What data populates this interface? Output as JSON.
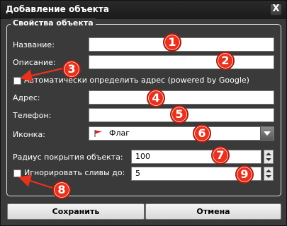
{
  "window": {
    "title": "Добавление объекта",
    "close_label": "X"
  },
  "fieldset": {
    "legend": "Свойства объекта"
  },
  "form": {
    "name_label": "Название:",
    "name_value": "",
    "description_label": "Описание:",
    "description_value": "",
    "auto_address_label": "Автоматически определить адрес (powered by Google)",
    "auto_address_checked": false,
    "address_label": "Адрес:",
    "address_value": "",
    "phone_label": "Телефон:",
    "phone_value": "",
    "icon_label": "Иконка:",
    "icon_selected": "Флаг",
    "icon_selected_icon": "red-flag-icon",
    "radius_label": "Радиус покрытия объекта:",
    "radius_value": "100",
    "ignore_label": "Игнорировать сливы до:",
    "ignore_checked": false,
    "ignore_value": "5"
  },
  "buttons": {
    "save": "Сохранить",
    "cancel": "Отмена"
  },
  "markers": [
    "1",
    "2",
    "3",
    "4",
    "5",
    "6",
    "7",
    "8",
    "9"
  ],
  "colors": {
    "background": "#3a3a3a",
    "marker": "#e8321e",
    "arrow": "#e8321e"
  }
}
